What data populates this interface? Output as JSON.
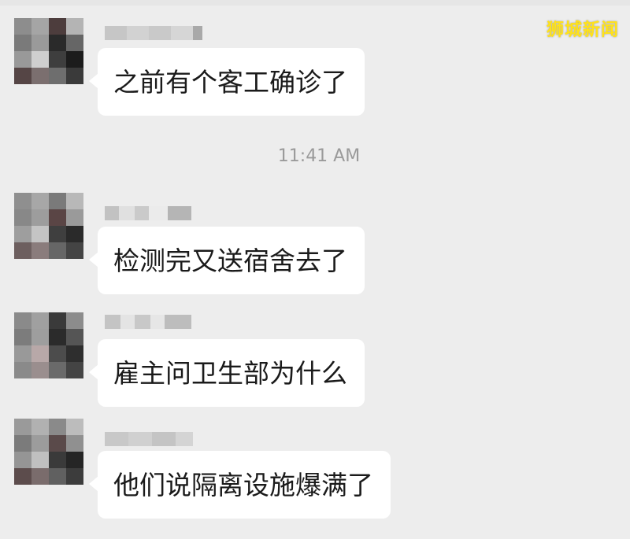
{
  "watermark": "狮城新闻",
  "messages": [
    {
      "text": "之前有个客工确诊了"
    },
    {
      "text": "检测完又送宿舍去了"
    },
    {
      "text": "雇主问卫生部为什么"
    },
    {
      "text": "他们说隔离设施爆满了"
    }
  ],
  "timestamp": "11:41 AM",
  "colors": {
    "background": "#ededed",
    "bubble": "#ffffff",
    "timestamp": "#9a9a9a",
    "watermark": "#ffe21a"
  }
}
